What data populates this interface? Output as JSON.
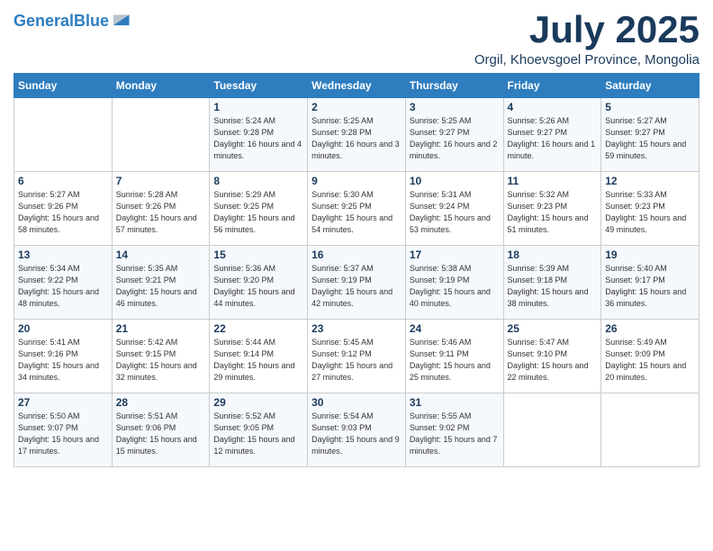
{
  "header": {
    "logo_line1": "General",
    "logo_line2": "Blue",
    "month": "July 2025",
    "location": "Orgil, Khoevsgoel Province, Mongolia"
  },
  "weekdays": [
    "Sunday",
    "Monday",
    "Tuesday",
    "Wednesday",
    "Thursday",
    "Friday",
    "Saturday"
  ],
  "weeks": [
    [
      {
        "day": "",
        "sunrise": "",
        "sunset": "",
        "daylight": ""
      },
      {
        "day": "",
        "sunrise": "",
        "sunset": "",
        "daylight": ""
      },
      {
        "day": "1",
        "sunrise": "Sunrise: 5:24 AM",
        "sunset": "Sunset: 9:28 PM",
        "daylight": "Daylight: 16 hours and 4 minutes."
      },
      {
        "day": "2",
        "sunrise": "Sunrise: 5:25 AM",
        "sunset": "Sunset: 9:28 PM",
        "daylight": "Daylight: 16 hours and 3 minutes."
      },
      {
        "day": "3",
        "sunrise": "Sunrise: 5:25 AM",
        "sunset": "Sunset: 9:27 PM",
        "daylight": "Daylight: 16 hours and 2 minutes."
      },
      {
        "day": "4",
        "sunrise": "Sunrise: 5:26 AM",
        "sunset": "Sunset: 9:27 PM",
        "daylight": "Daylight: 16 hours and 1 minute."
      },
      {
        "day": "5",
        "sunrise": "Sunrise: 5:27 AM",
        "sunset": "Sunset: 9:27 PM",
        "daylight": "Daylight: 15 hours and 59 minutes."
      }
    ],
    [
      {
        "day": "6",
        "sunrise": "Sunrise: 5:27 AM",
        "sunset": "Sunset: 9:26 PM",
        "daylight": "Daylight: 15 hours and 58 minutes."
      },
      {
        "day": "7",
        "sunrise": "Sunrise: 5:28 AM",
        "sunset": "Sunset: 9:26 PM",
        "daylight": "Daylight: 15 hours and 57 minutes."
      },
      {
        "day": "8",
        "sunrise": "Sunrise: 5:29 AM",
        "sunset": "Sunset: 9:25 PM",
        "daylight": "Daylight: 15 hours and 56 minutes."
      },
      {
        "day": "9",
        "sunrise": "Sunrise: 5:30 AM",
        "sunset": "Sunset: 9:25 PM",
        "daylight": "Daylight: 15 hours and 54 minutes."
      },
      {
        "day": "10",
        "sunrise": "Sunrise: 5:31 AM",
        "sunset": "Sunset: 9:24 PM",
        "daylight": "Daylight: 15 hours and 53 minutes."
      },
      {
        "day": "11",
        "sunrise": "Sunrise: 5:32 AM",
        "sunset": "Sunset: 9:23 PM",
        "daylight": "Daylight: 15 hours and 51 minutes."
      },
      {
        "day": "12",
        "sunrise": "Sunrise: 5:33 AM",
        "sunset": "Sunset: 9:23 PM",
        "daylight": "Daylight: 15 hours and 49 minutes."
      }
    ],
    [
      {
        "day": "13",
        "sunrise": "Sunrise: 5:34 AM",
        "sunset": "Sunset: 9:22 PM",
        "daylight": "Daylight: 15 hours and 48 minutes."
      },
      {
        "day": "14",
        "sunrise": "Sunrise: 5:35 AM",
        "sunset": "Sunset: 9:21 PM",
        "daylight": "Daylight: 15 hours and 46 minutes."
      },
      {
        "day": "15",
        "sunrise": "Sunrise: 5:36 AM",
        "sunset": "Sunset: 9:20 PM",
        "daylight": "Daylight: 15 hours and 44 minutes."
      },
      {
        "day": "16",
        "sunrise": "Sunrise: 5:37 AM",
        "sunset": "Sunset: 9:19 PM",
        "daylight": "Daylight: 15 hours and 42 minutes."
      },
      {
        "day": "17",
        "sunrise": "Sunrise: 5:38 AM",
        "sunset": "Sunset: 9:19 PM",
        "daylight": "Daylight: 15 hours and 40 minutes."
      },
      {
        "day": "18",
        "sunrise": "Sunrise: 5:39 AM",
        "sunset": "Sunset: 9:18 PM",
        "daylight": "Daylight: 15 hours and 38 minutes."
      },
      {
        "day": "19",
        "sunrise": "Sunrise: 5:40 AM",
        "sunset": "Sunset: 9:17 PM",
        "daylight": "Daylight: 15 hours and 36 minutes."
      }
    ],
    [
      {
        "day": "20",
        "sunrise": "Sunrise: 5:41 AM",
        "sunset": "Sunset: 9:16 PM",
        "daylight": "Daylight: 15 hours and 34 minutes."
      },
      {
        "day": "21",
        "sunrise": "Sunrise: 5:42 AM",
        "sunset": "Sunset: 9:15 PM",
        "daylight": "Daylight: 15 hours and 32 minutes."
      },
      {
        "day": "22",
        "sunrise": "Sunrise: 5:44 AM",
        "sunset": "Sunset: 9:14 PM",
        "daylight": "Daylight: 15 hours and 29 minutes."
      },
      {
        "day": "23",
        "sunrise": "Sunrise: 5:45 AM",
        "sunset": "Sunset: 9:12 PM",
        "daylight": "Daylight: 15 hours and 27 minutes."
      },
      {
        "day": "24",
        "sunrise": "Sunrise: 5:46 AM",
        "sunset": "Sunset: 9:11 PM",
        "daylight": "Daylight: 15 hours and 25 minutes."
      },
      {
        "day": "25",
        "sunrise": "Sunrise: 5:47 AM",
        "sunset": "Sunset: 9:10 PM",
        "daylight": "Daylight: 15 hours and 22 minutes."
      },
      {
        "day": "26",
        "sunrise": "Sunrise: 5:49 AM",
        "sunset": "Sunset: 9:09 PM",
        "daylight": "Daylight: 15 hours and 20 minutes."
      }
    ],
    [
      {
        "day": "27",
        "sunrise": "Sunrise: 5:50 AM",
        "sunset": "Sunset: 9:07 PM",
        "daylight": "Daylight: 15 hours and 17 minutes."
      },
      {
        "day": "28",
        "sunrise": "Sunrise: 5:51 AM",
        "sunset": "Sunset: 9:06 PM",
        "daylight": "Daylight: 15 hours and 15 minutes."
      },
      {
        "day": "29",
        "sunrise": "Sunrise: 5:52 AM",
        "sunset": "Sunset: 9:05 PM",
        "daylight": "Daylight: 15 hours and 12 minutes."
      },
      {
        "day": "30",
        "sunrise": "Sunrise: 5:54 AM",
        "sunset": "Sunset: 9:03 PM",
        "daylight": "Daylight: 15 hours and 9 minutes."
      },
      {
        "day": "31",
        "sunrise": "Sunrise: 5:55 AM",
        "sunset": "Sunset: 9:02 PM",
        "daylight": "Daylight: 15 hours and 7 minutes."
      },
      {
        "day": "",
        "sunrise": "",
        "sunset": "",
        "daylight": ""
      },
      {
        "day": "",
        "sunrise": "",
        "sunset": "",
        "daylight": ""
      }
    ]
  ]
}
